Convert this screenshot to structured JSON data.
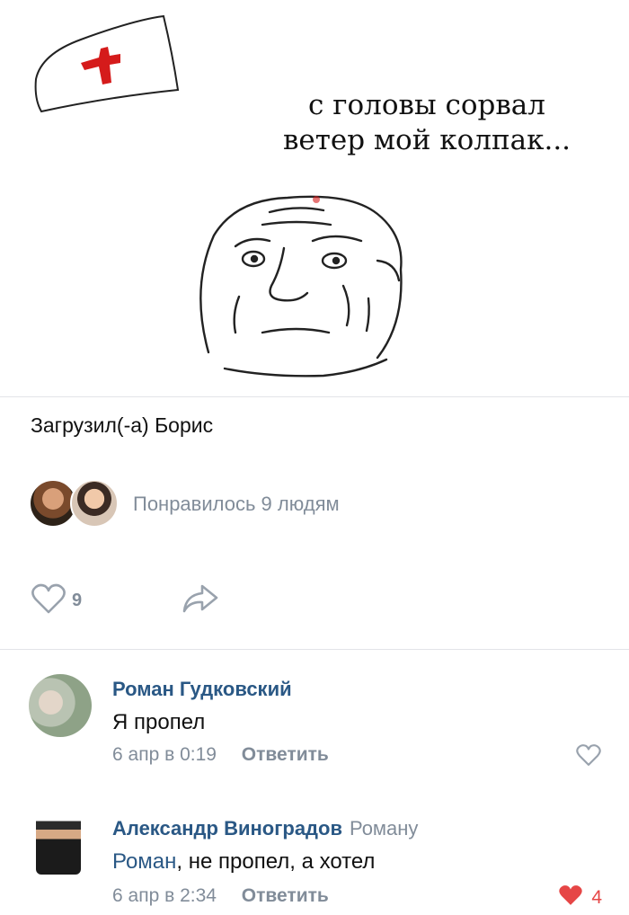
{
  "post": {
    "meme_caption_line1": "с головы сорвал",
    "meme_caption_line2": "ветер мой колпак...",
    "uploader": "Загрузил(-а) Борис",
    "likes_text": "Понравилось 9 людям",
    "like_count": "9"
  },
  "comments": [
    {
      "author": "Роман Гудковский",
      "text": "Я пропел",
      "time": "6 апр в 0:19",
      "reply_label": "Ответить"
    },
    {
      "author": "Александр Виноградов",
      "reply_to": "Роману",
      "mention": "Роман",
      "text_rest": ", не пропел, а хотел",
      "time": "6 апр в 2:34",
      "reply_label": "Ответить",
      "likes": "4"
    }
  ],
  "icons": {
    "like": "heart-outline-icon",
    "liked": "heart-filled-icon",
    "share": "share-arrow-icon"
  },
  "colors": {
    "link": "#2a5885",
    "muted": "#818c99",
    "liked": "#e64646"
  }
}
